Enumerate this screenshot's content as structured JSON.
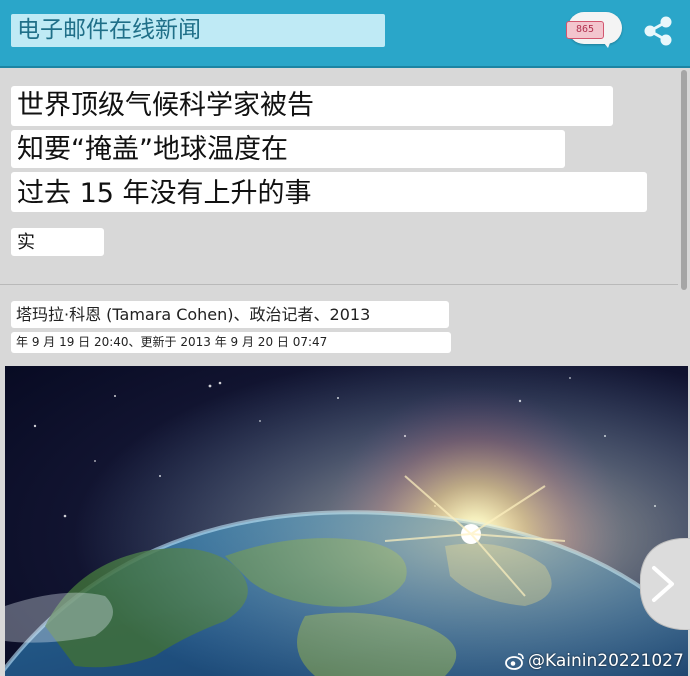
{
  "app": {
    "title": "电子邮件在线新闻",
    "notification_count": "865"
  },
  "article": {
    "headline_lines": [
      "世界顶级气候科学家被告",
      "知要“掩盖”地球温度在",
      "过去 15 年没有上升的事",
      "实"
    ],
    "byline": "塔玛拉·科恩 (Tamara Cohen)、政治记者、2013",
    "dateline": "年 9 月 19 日 20:40、更新于 2013 年 9 月 20 日 07:47"
  },
  "watermark": {
    "text": "@Kainin20221027"
  },
  "icons": {
    "notification": "speech-bubble-icon",
    "share": "share-icon",
    "next": "chevron-right-icon",
    "watermark": "weibo-icon"
  },
  "colors": {
    "topbar": "#2aa6c9",
    "title_field": "#bfeaf5",
    "page_bg": "#d8d8d8",
    "badge_text": "#b13250"
  }
}
